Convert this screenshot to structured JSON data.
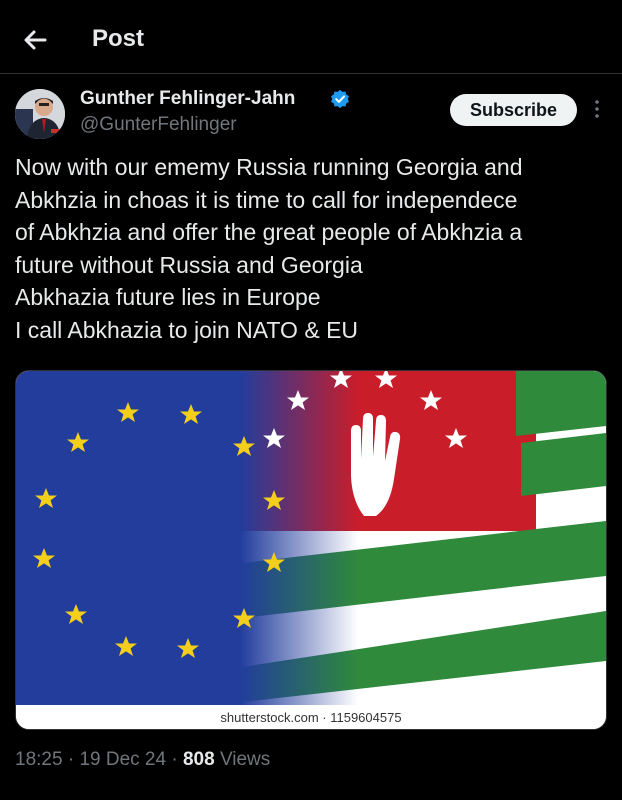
{
  "header": {
    "title": "Post",
    "back_icon": "arrow-left-icon"
  },
  "author": {
    "name": "Gunther Fehlinger-Jahn",
    "handle": "@GunterFehlinger",
    "verified_icon": "verified-badge-icon",
    "verified_color": "#1d9bf0"
  },
  "actions": {
    "subscribe_label": "Subscribe",
    "more_icon": "more-vertical-icon"
  },
  "tweet": {
    "lines": [
      "Now with our ememy Russia running Georgia and",
      "Abkhzia in choas it is time to call for independece",
      "of Abkhzia and offer the great people of Abkhzia a",
      "future without Russia and Georgia",
      "Abkhazia future lies in Europe",
      "I call Abkhazia to join NATO & EU"
    ]
  },
  "media": {
    "credit": "shutterstock.com · 1159604575",
    "eu_blue": "#223d9c",
    "star_gold": "#f3cf1c",
    "abkhazia_red": "#c91d2a",
    "abkhazia_green": "#2f8a3c"
  },
  "meta": {
    "time": "18:25",
    "sep": "·",
    "date": "19 Dec 24",
    "views_count": "808",
    "views_label": "Views"
  }
}
